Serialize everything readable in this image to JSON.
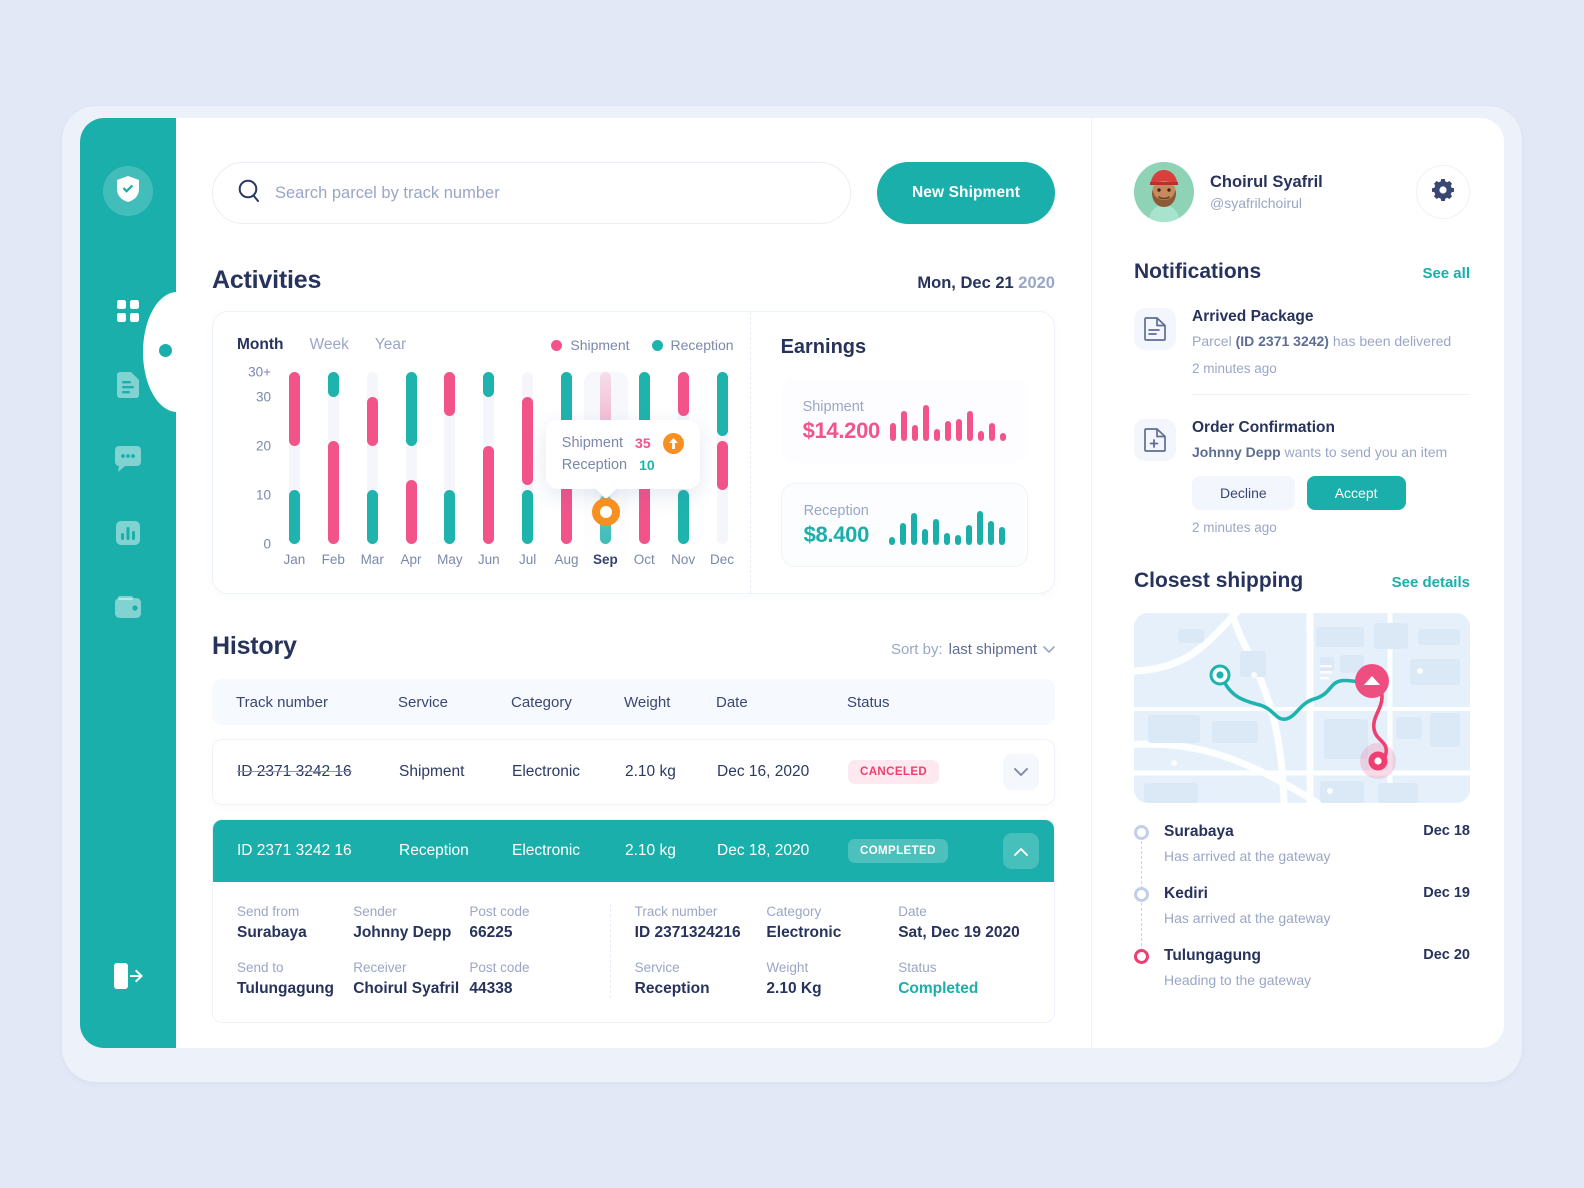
{
  "sidebar": {
    "logo_icon": "shield-check-icon",
    "items": [
      {
        "icon": "grid-dashboard-icon",
        "name": "dashboard",
        "active": true
      },
      {
        "icon": "document-icon",
        "name": "documents",
        "active": false
      },
      {
        "icon": "chat-bubble-icon",
        "name": "messages",
        "active": false
      },
      {
        "icon": "bar-chart-icon",
        "name": "statistics",
        "active": false
      },
      {
        "icon": "wallet-icon",
        "name": "wallet",
        "active": false
      }
    ],
    "logout_icon": "logout-icon"
  },
  "search": {
    "placeholder": "Search parcel by track number",
    "value": "",
    "icon": "search-icon"
  },
  "toolbar": {
    "new_shipment_label": "New Shipment"
  },
  "activities": {
    "title": "Activities",
    "date_day": "Mon, Dec 21",
    "date_year": "2020",
    "tabs": [
      {
        "label": "Month",
        "active": true
      },
      {
        "label": "Week",
        "active": false
      },
      {
        "label": "Year",
        "active": false
      }
    ],
    "legend": [
      {
        "label": "Shipment",
        "color": "#f2548a"
      },
      {
        "label": "Reception",
        "color": "#1fb3ae"
      }
    ],
    "tooltip": {
      "shipment_label": "Shipment",
      "shipment_value": "35",
      "reception_label": "Reception",
      "reception_value": "10",
      "badge_icon": "arrow-up-icon"
    }
  },
  "chart_data": {
    "type": "bar",
    "title": "Activities",
    "xlabel": "",
    "ylabel": "",
    "ylim": [
      0,
      35
    ],
    "ytick_labels": [
      "0",
      "10",
      "20",
      "30",
      "30+"
    ],
    "ytick_values": [
      0,
      10,
      20,
      30,
      35
    ],
    "grid": false,
    "legend_position": "top-right",
    "categories": [
      "Jan",
      "Feb",
      "Mar",
      "Apr",
      "May",
      "Jun",
      "Jul",
      "Aug",
      "Sep",
      "Oct",
      "Nov",
      "Dec"
    ],
    "highlighted_category": "Sep",
    "note": "Floating range bars: each month has one Shipment segment and one Reception segment drawn on a light grey full-height track. Values are [from, to] on the y axis.",
    "series": [
      {
        "name": "Shipment",
        "color": "#f2548a",
        "ranges": [
          [
            20,
            35
          ],
          [
            0,
            21
          ],
          [
            20,
            30
          ],
          [
            0,
            13
          ],
          [
            26,
            35
          ],
          [
            0,
            20
          ],
          [
            12,
            30
          ],
          [
            0,
            22
          ],
          [
            22,
            35
          ],
          [
            0,
            13
          ],
          [
            26,
            35
          ],
          [
            11,
            21
          ]
        ]
      },
      {
        "name": "Reception",
        "color": "#1fb3ae",
        "ranges": [
          [
            0,
            11
          ],
          [
            30,
            35
          ],
          [
            0,
            11
          ],
          [
            20,
            35
          ],
          [
            0,
            11
          ],
          [
            30,
            35
          ],
          [
            0,
            11
          ],
          [
            16,
            35
          ],
          [
            0,
            10
          ],
          [
            22,
            35
          ],
          [
            0,
            11
          ],
          [
            22,
            35
          ]
        ]
      }
    ],
    "tooltip_point": {
      "category": "Sep",
      "shipment": 35,
      "reception": 10
    }
  },
  "earnings": {
    "title": "Earnings",
    "cards": [
      {
        "label": "Shipment",
        "value": "$14.200",
        "color": "#f2548a",
        "sparkline": [
          18,
          30,
          16,
          36,
          12,
          20,
          22,
          30,
          10,
          18,
          8
        ]
      },
      {
        "label": "Reception",
        "value": "$8.400",
        "color": "#1aafab",
        "sparkline": [
          8,
          22,
          32,
          16,
          26,
          12,
          10,
          20,
          34,
          24,
          18
        ]
      }
    ]
  },
  "history": {
    "title": "History",
    "sort_prefix": "Sort by:",
    "sort_value": "last shipment",
    "sort_icon": "chevron-down-icon",
    "columns": [
      "Track number",
      "Service",
      "Category",
      "Weight",
      "Date",
      "Status"
    ],
    "rows": [
      {
        "track": "ID  2371  3242  16",
        "service": "Shipment",
        "category": "Electronic",
        "weight": "2.10 kg",
        "date": "Dec 16, 2020",
        "status": "CANCELED",
        "status_kind": "cancel",
        "expanded": false,
        "chevron": "chevron-down-icon"
      },
      {
        "track": "ID  2371  3242  16",
        "service": "Reception",
        "category": "Electronic",
        "weight": "2.10 kg",
        "date": "Dec 18, 2020",
        "status": "COMPLETED",
        "status_kind": "done",
        "expanded": true,
        "chevron": "chevron-up-icon"
      }
    ],
    "detail": {
      "left": [
        {
          "label": "Send from",
          "value": "Surabaya"
        },
        {
          "label": "Sender",
          "value": "Johnny Depp"
        },
        {
          "label": "Post code",
          "value": "66225"
        },
        {
          "label": "Send to",
          "value": "Tulungagung"
        },
        {
          "label": "Receiver",
          "value": "Choirul Syafril"
        },
        {
          "label": "Post code",
          "value": "44338"
        }
      ],
      "right": [
        {
          "label": "Track number",
          "value": "ID 2371324216"
        },
        {
          "label": "Category",
          "value": "Electronic"
        },
        {
          "label": "Date",
          "value": "Sat, Dec 19 2020"
        },
        {
          "label": "Service",
          "value": "Reception"
        },
        {
          "label": "Weight",
          "value": "2.10 Kg"
        },
        {
          "label": "Status",
          "value": "Completed",
          "accent": true
        }
      ]
    }
  },
  "profile": {
    "name": "Choirul Syafril",
    "handle": "@syafrilchoirul",
    "avatar_icon": "avatar",
    "settings_icon": "gear-icon"
  },
  "notifications": {
    "title": "Notifications",
    "see_all": "See all",
    "items": [
      {
        "icon": "document-text-icon",
        "title": "Arrived Package",
        "desc_pre": "Parcel ",
        "desc_strong": "(ID 2371 3242)",
        "desc_post": " has been delivered",
        "time": "2 minutes ago",
        "actions": []
      },
      {
        "icon": "document-add-icon",
        "title": "Order Confirmation",
        "desc_pre": "",
        "desc_strong": "Johnny Depp",
        "desc_post": " wants to send you an item",
        "time": "2 minutes ago",
        "actions": [
          {
            "label": "Decline",
            "kind": "decline"
          },
          {
            "label": "Accept",
            "kind": "accept"
          }
        ]
      }
    ]
  },
  "closest_shipping": {
    "title": "Closest shipping",
    "see_details": "See details",
    "map": {
      "origin_icon": "origin-pin-icon",
      "vehicle_icon": "truck-pin-icon",
      "destination_icon": "destination-pin-icon",
      "route_colors": [
        "#1fb3ae",
        "#ee3f70"
      ]
    },
    "timeline": [
      {
        "city": "Surabaya",
        "status": "Has arrived at the gateway",
        "date": "Dec 18",
        "current": false
      },
      {
        "city": "Kediri",
        "status": "Has arrived at the gateway",
        "date": "Dec 19",
        "current": false
      },
      {
        "city": "Tulungagung",
        "status": "Heading to the gateway",
        "date": "Dec 20",
        "current": true
      }
    ]
  },
  "colors": {
    "brand": "#1aafab",
    "shipment": "#f2548a",
    "reception": "#1fb3ae",
    "accent": "#f79021",
    "danger": "#ee3f70",
    "ink": "#27335c",
    "muted": "#9aa6c6",
    "page_bg": "#e2e8f5"
  }
}
